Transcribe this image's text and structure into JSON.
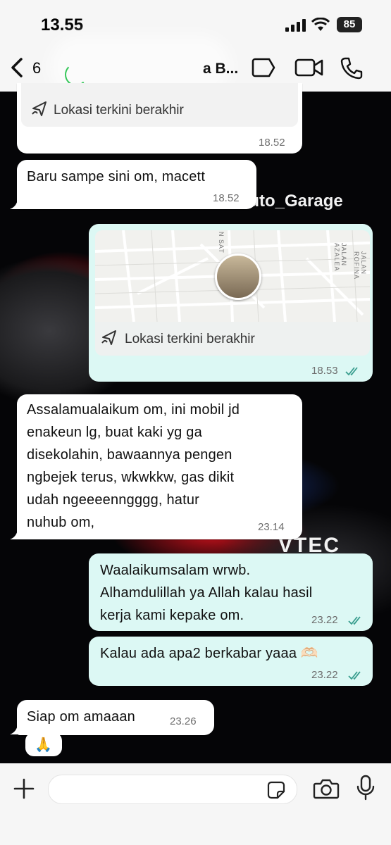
{
  "status_bar": {
    "time": "13.55",
    "battery": "85"
  },
  "header": {
    "back_count": "6",
    "contact_name_partial": "a B...",
    "icons": [
      "chevron-left-icon",
      "sticker-icon",
      "video-call-icon",
      "phone-icon"
    ]
  },
  "wallpaper": {
    "overlay_text": "_uto_Garage",
    "engine_text": "VTEC"
  },
  "messages": [
    {
      "direction": "in",
      "kind": "location",
      "label": "Lokasi terkini berakhir",
      "time": "18.52"
    },
    {
      "direction": "in",
      "text": "Baru sampe sini om, macett",
      "time": "18.52"
    },
    {
      "direction": "out",
      "kind": "location",
      "label": "Lokasi terkini berakhir",
      "time": "18.53",
      "streets": [
        "N SAT",
        "JALAN AZALEA",
        "JALAN ROFINA"
      ]
    },
    {
      "direction": "in",
      "lines": [
        "Assalamualaikum om, ini mobil jd",
        "enakeun lg, buat kaki yg ga",
        "disekolahin, bawaannya pengen",
        "ngbejek terus, wkwkkw, gas dikit",
        "udah ngeeeenngggg, hatur",
        "nuhub om,"
      ],
      "time": "23.14"
    },
    {
      "direction": "out",
      "lines": [
        "Waalaikumsalam wrwb.",
        "Alhamdulillah ya Allah kalau hasil",
        "kerja kami kepake om."
      ],
      "time": "23.22"
    },
    {
      "direction": "out",
      "text": "Kalau ada apa2 berkabar yaaa 🫶🏻",
      "time": "23.22"
    },
    {
      "direction": "in",
      "text": "Siap om amaaan",
      "time": "23.26",
      "reaction": "🙏"
    }
  ],
  "input_bar": {
    "placeholder": "",
    "icons": [
      "plus-icon",
      "sticker-icon",
      "camera-icon",
      "microphone-icon"
    ]
  },
  "colors": {
    "incoming": "#ffffff",
    "outgoing": "#dcf8f4",
    "read_ticks": "#3a9e8f",
    "header_bg": "#f6f6f6"
  }
}
